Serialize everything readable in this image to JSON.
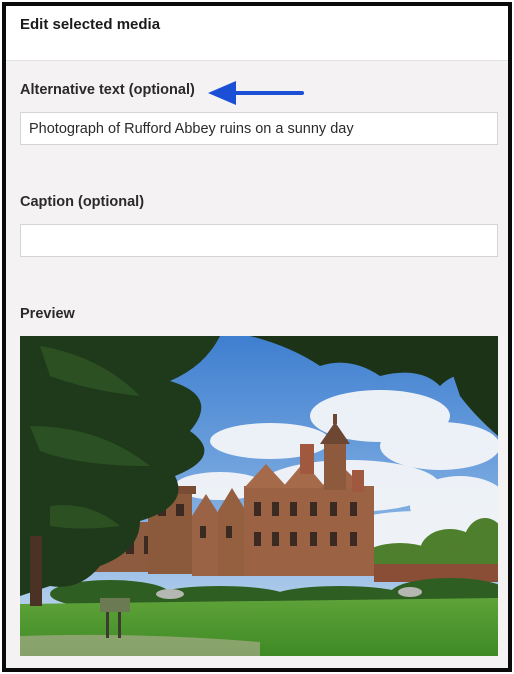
{
  "dialog": {
    "title": "Edit selected media"
  },
  "alt_text": {
    "label": "Alternative text (optional)",
    "value": "Photograph of Rufford Abbey ruins on a sunny day",
    "placeholder": ""
  },
  "caption": {
    "label": "Caption (optional)",
    "value": "",
    "placeholder": ""
  },
  "preview": {
    "label": "Preview",
    "image_subject": "Rufford Abbey ruins on a sunny day"
  },
  "annotation": {
    "icon": "arrow-left-icon",
    "color": "#1a4fd6"
  },
  "colors": {
    "panel_bg": "#f4f2f2",
    "header_bg": "#ffffff",
    "border": "#0a0a0a"
  }
}
